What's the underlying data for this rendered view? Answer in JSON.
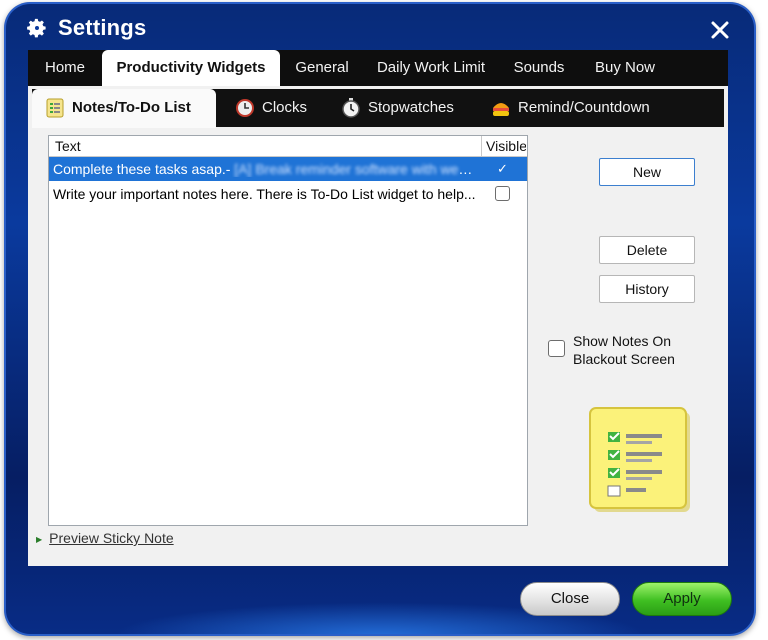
{
  "window": {
    "title": "Settings",
    "colors": {
      "frame": "#0a3a9e",
      "tabbar": "#0e0e0e",
      "selection": "#1f73d6",
      "apply": "#3fbf22"
    }
  },
  "main_tabs": [
    {
      "label": "Home",
      "active": false
    },
    {
      "label": "Productivity Widgets",
      "active": true
    },
    {
      "label": "General",
      "active": false
    },
    {
      "label": "Daily Work Limit",
      "active": false
    },
    {
      "label": "Sounds",
      "active": false
    },
    {
      "label": "Buy Now",
      "active": false
    }
  ],
  "sub_tabs": [
    {
      "label": "Notes/To-Do List",
      "icon": "notes-icon",
      "active": true
    },
    {
      "label": "Clocks",
      "icon": "clock-icon",
      "active": false
    },
    {
      "label": "Stopwatches",
      "icon": "stopwatch-icon",
      "active": false
    },
    {
      "label": "Remind/Countdown",
      "icon": "remind-icon",
      "active": false
    }
  ],
  "notes_list": {
    "columns": {
      "text": "Text",
      "visible": "Visible"
    },
    "rows": [
      {
        "text": "Complete these tasks asap.-",
        "text_blurred": " [A] Break reminder software with web...",
        "visible": true,
        "selected": true
      },
      {
        "text": "Write your important notes here. There is To-Do List widget to help...",
        "visible": false,
        "selected": false
      }
    ]
  },
  "buttons": {
    "new": "New",
    "delete": "Delete",
    "history": "History"
  },
  "blackout_option": {
    "line1": "Show Notes On",
    "line2": "Blackout Screen",
    "checked": false
  },
  "preview_link": "Preview Sticky Note",
  "footer": {
    "close": "Close",
    "apply": "Apply"
  }
}
